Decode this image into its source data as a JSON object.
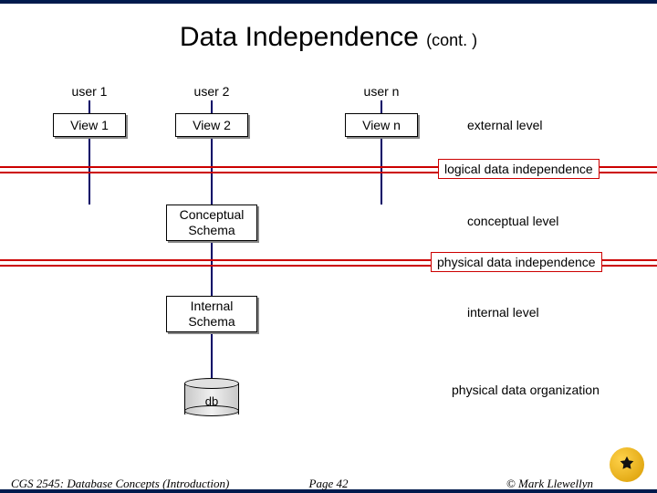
{
  "title_main": "Data Independence ",
  "title_sub": "(cont. )",
  "users": {
    "u1": "user 1",
    "u2": "user 2",
    "un": "user n"
  },
  "views": {
    "v1": "View 1",
    "v2": "View 2",
    "vn": "View n"
  },
  "levels": {
    "external": "external level",
    "conceptual": "conceptual level",
    "internal": "internal level",
    "physical_org": "physical data organization"
  },
  "independence": {
    "logical": "logical data independence",
    "physical": "physical data independence"
  },
  "schemas": {
    "conceptual": "Conceptual Schema",
    "internal": "Internal Schema"
  },
  "db_label": "db",
  "footer": {
    "left": "CGS 2545: Database Concepts  (Introduction)",
    "center": "Page 42",
    "right": "© Mark Llewellyn"
  }
}
